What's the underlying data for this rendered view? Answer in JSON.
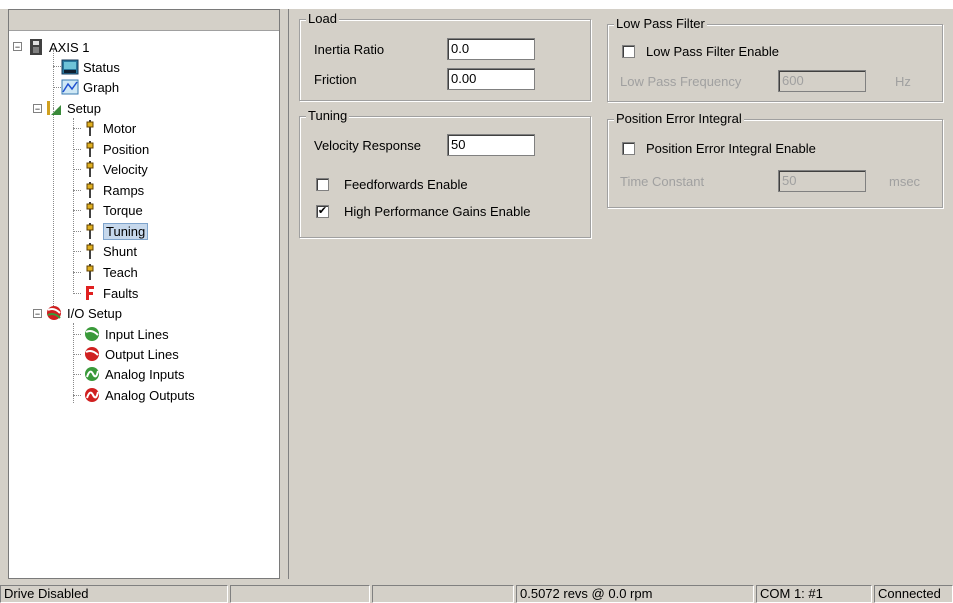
{
  "tree": {
    "root": {
      "label": "AXIS 1",
      "icon": "drive-icon"
    },
    "items": [
      {
        "label": "Status",
        "icon": "status-monitor-icon"
      },
      {
        "label": "Graph",
        "icon": "graph-icon"
      },
      {
        "label": "Setup",
        "icon": "setup-icon"
      },
      {
        "label": "Motor",
        "icon": "parameter-icon"
      },
      {
        "label": "Position",
        "icon": "parameter-icon"
      },
      {
        "label": "Velocity",
        "icon": "parameter-icon"
      },
      {
        "label": "Ramps",
        "icon": "parameter-icon"
      },
      {
        "label": "Torque",
        "icon": "parameter-icon"
      },
      {
        "label": "Tuning",
        "icon": "parameter-icon",
        "selected": true
      },
      {
        "label": "Shunt",
        "icon": "parameter-icon"
      },
      {
        "label": "Teach",
        "icon": "parameter-icon"
      },
      {
        "label": "Faults",
        "icon": "faults-icon"
      },
      {
        "label": "I/O Setup",
        "icon": "io-setup-icon"
      },
      {
        "label": "Input Lines",
        "icon": "input-lines-icon"
      },
      {
        "label": "Output Lines",
        "icon": "output-lines-icon"
      },
      {
        "label": "Analog Inputs",
        "icon": "analog-inputs-icon"
      },
      {
        "label": "Analog Outputs",
        "icon": "analog-outputs-icon"
      }
    ]
  },
  "load": {
    "title": "Load",
    "inertia_label": "Inertia Ratio",
    "inertia_value": "0.0",
    "friction_label": "Friction",
    "friction_value": "0.00"
  },
  "tuning": {
    "title": "Tuning",
    "velocity_label": "Velocity Response",
    "velocity_value": "50",
    "feedforwards_label": "Feedforwards Enable",
    "feedforwards_checked": false,
    "highperf_label": "High Performance Gains Enable",
    "highperf_checked": true
  },
  "lowpass": {
    "title": "Low Pass Filter",
    "enable_label": "Low Pass Filter Enable",
    "enable_checked": false,
    "freq_label": "Low Pass Frequency",
    "freq_value": "600",
    "freq_unit": "Hz"
  },
  "poserr": {
    "title": "Position Error Integral",
    "enable_label": "Position Error Integral Enable",
    "enable_checked": false,
    "tc_label": "Time Constant",
    "tc_value": "50",
    "tc_unit": "msec"
  },
  "statusbar": {
    "drive": "Drive Disabled",
    "empty1": "",
    "empty2": "",
    "position": "0.5072 revs @ 0.0 rpm",
    "port": "COM 1: #1",
    "connection": "Connected"
  },
  "check_mark": "✔",
  "colors": {
    "selection": "#c6d8ec",
    "background": "#d4d0c8",
    "faults_red": "#e02020"
  }
}
